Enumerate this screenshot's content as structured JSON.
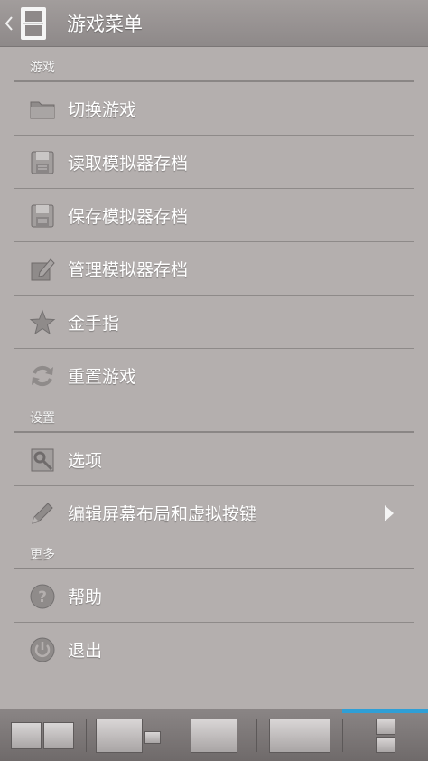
{
  "action_bar": {
    "back_icon": "chevron-left-icon",
    "logo_icon": "ds-console-icon",
    "title": "游戏菜单"
  },
  "sections": [
    {
      "header": "游戏",
      "items": [
        {
          "label": "切换游戏",
          "icon": "folder-icon"
        },
        {
          "label": "读取模拟器存档",
          "icon": "floppy-disk-icon"
        },
        {
          "label": "保存模拟器存档",
          "icon": "floppy-disk-icon"
        },
        {
          "label": "管理模拟器存档",
          "icon": "edit-document-icon"
        },
        {
          "label": "金手指",
          "icon": "star-icon"
        },
        {
          "label": "重置游戏",
          "icon": "refresh-icon"
        }
      ]
    },
    {
      "header": "设置",
      "items": [
        {
          "label": "选项",
          "icon": "wrench-icon"
        },
        {
          "label": "编辑屏幕布局和虚拟按键",
          "icon": "pencil-icon",
          "submenu": true
        }
      ]
    },
    {
      "header": "更多",
      "items": [
        {
          "label": "帮助",
          "icon": "help-icon"
        },
        {
          "label": "退出",
          "icon": "power-icon"
        }
      ]
    }
  ],
  "bottom_bar": {
    "tabs": [
      {
        "icon": "layout-side-by-side-icon"
      },
      {
        "icon": "layout-main-small-icon"
      },
      {
        "icon": "layout-single-screen-icon"
      },
      {
        "icon": "layout-wide-screen-icon"
      },
      {
        "icon": "layout-stacked-icon",
        "selected": true
      }
    ],
    "accent_color": "#2f9fd6"
  },
  "colors": {
    "background": "#b4afae",
    "action_bar": "#979292",
    "text": "#ffffff"
  }
}
